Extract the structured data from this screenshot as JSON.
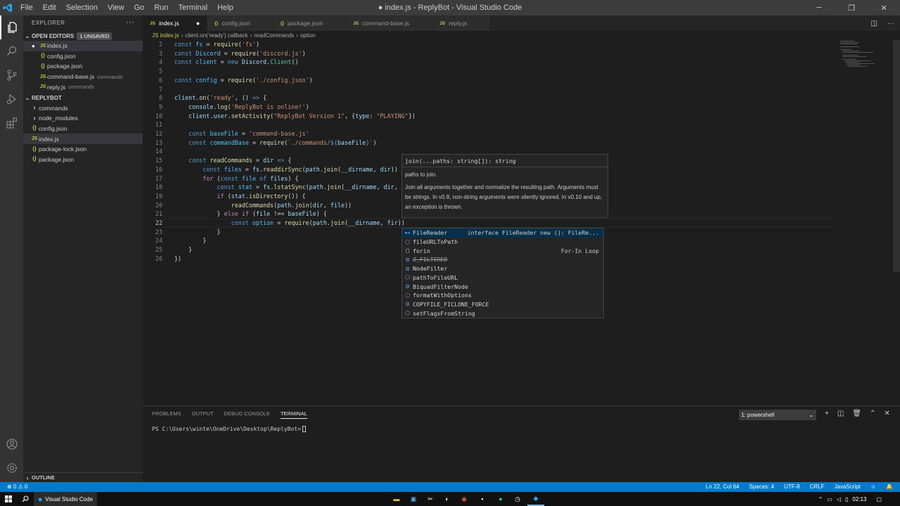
{
  "window": {
    "title": "● index.js - ReplyBot - Visual Studio Code",
    "menus": [
      "File",
      "Edit",
      "Selection",
      "View",
      "Go",
      "Run",
      "Terminal",
      "Help"
    ],
    "controls": [
      "─",
      "❐",
      "✕"
    ]
  },
  "sidebar": {
    "header": "EXPLORER",
    "more": "···",
    "open_editors": {
      "title": "OPEN EDITORS",
      "badge": "1 UNSAVED"
    },
    "open_files": [
      {
        "icon": "JS",
        "name": "index.js",
        "desc": ""
      },
      {
        "icon": "{}",
        "name": "config.json",
        "desc": ""
      },
      {
        "icon": "{}",
        "name": "package.json",
        "desc": ""
      },
      {
        "icon": "JS",
        "name": "command-base.js",
        "desc": "commands"
      },
      {
        "icon": "JS",
        "name": "reply.js",
        "desc": "commands"
      }
    ],
    "project": {
      "title": "REPLYBOT"
    },
    "tree": [
      {
        "icon": "›",
        "name": "commands"
      },
      {
        "icon": "›",
        "name": "node_modules"
      },
      {
        "icon": "{}",
        "name": "config.json"
      },
      {
        "icon": "JS",
        "name": "index.js"
      },
      {
        "icon": "{}",
        "name": "package-lock.json"
      },
      {
        "icon": "{}",
        "name": "package.json"
      }
    ],
    "outline": "OUTLINE"
  },
  "tabs": [
    {
      "icon": "JS",
      "label": "index.js",
      "dirty": "●"
    },
    {
      "icon": "{}",
      "label": "config.json"
    },
    {
      "icon": "{}",
      "label": "package.json"
    },
    {
      "icon": "JS",
      "label": "command-base.js"
    },
    {
      "icon": "JS",
      "label": "reply.js"
    }
  ],
  "tab_actions": [
    "◫",
    "···"
  ],
  "breadcrumb": [
    "JS index.js",
    "client.on('ready') callback",
    "readCommands",
    "option"
  ],
  "editor": {
    "line_numbers": [
      "2",
      "3",
      "4",
      "5",
      "6",
      "7",
      "8",
      "9",
      "10",
      "11",
      "12",
      "13",
      "14",
      "15",
      "16",
      "17",
      "18",
      "19",
      "20",
      "21",
      "22",
      "23",
      "24",
      "25",
      "26"
    ],
    "current_line": "22"
  },
  "hover": {
    "signature": "join(...paths: string[]): string",
    "param": "paths to join.",
    "description": "Join all arguments together and normalize the resulting path. Arguments must be strings. In v0.8, non-string arguments were silently ignored. In v0.10 and up, an exception is thrown."
  },
  "suggestions": [
    {
      "kind": "interface",
      "label": "FileReader",
      "detail": "interface FileReader new (): FileRe..."
    },
    {
      "kind": "function",
      "label": "fileURLToPath",
      "detail": ""
    },
    {
      "kind": "snippet",
      "label": "forin",
      "detail": "For-In Loop"
    },
    {
      "kind": "variable",
      "label": "Z_FILTERED",
      "detail": ""
    },
    {
      "kind": "variable",
      "label": "NodeFilter",
      "detail": ""
    },
    {
      "kind": "function",
      "label": "pathToFileURL",
      "detail": ""
    },
    {
      "kind": "variable",
      "label": "BiquadFilterNode",
      "detail": ""
    },
    {
      "kind": "function",
      "label": "formatWithOptions",
      "detail": ""
    },
    {
      "kind": "variable",
      "label": "COPYFILE_FICLONE_FORCE",
      "detail": ""
    },
    {
      "kind": "function",
      "label": "setFlagsFromString",
      "detail": ""
    }
  ],
  "panel": {
    "tabs": [
      "PROBLEMS",
      "OUTPUT",
      "DEBUG CONSOLE",
      "TERMINAL"
    ],
    "active_tab": "TERMINAL",
    "terminal_select": "1: powershell",
    "actions": [
      "+",
      "◫",
      "🗑",
      "⌃",
      "✕"
    ],
    "prompt": "PS C:\\Users\\winte\\OneDrive\\Desktop\\ReplyBot>"
  },
  "statusbar": {
    "left": "⊗ 0 ⚠ 0",
    "right": [
      "Ln 22, Col 64",
      "Spaces: 4",
      "UTF-8",
      "CRLF",
      "JavaScript",
      "☺",
      "🔔"
    ]
  },
  "taskbar": {
    "app": "Visual Studio Code",
    "time": "02:13"
  },
  "colors": {
    "accent": "#007acc",
    "selection": "#062f4a"
  }
}
